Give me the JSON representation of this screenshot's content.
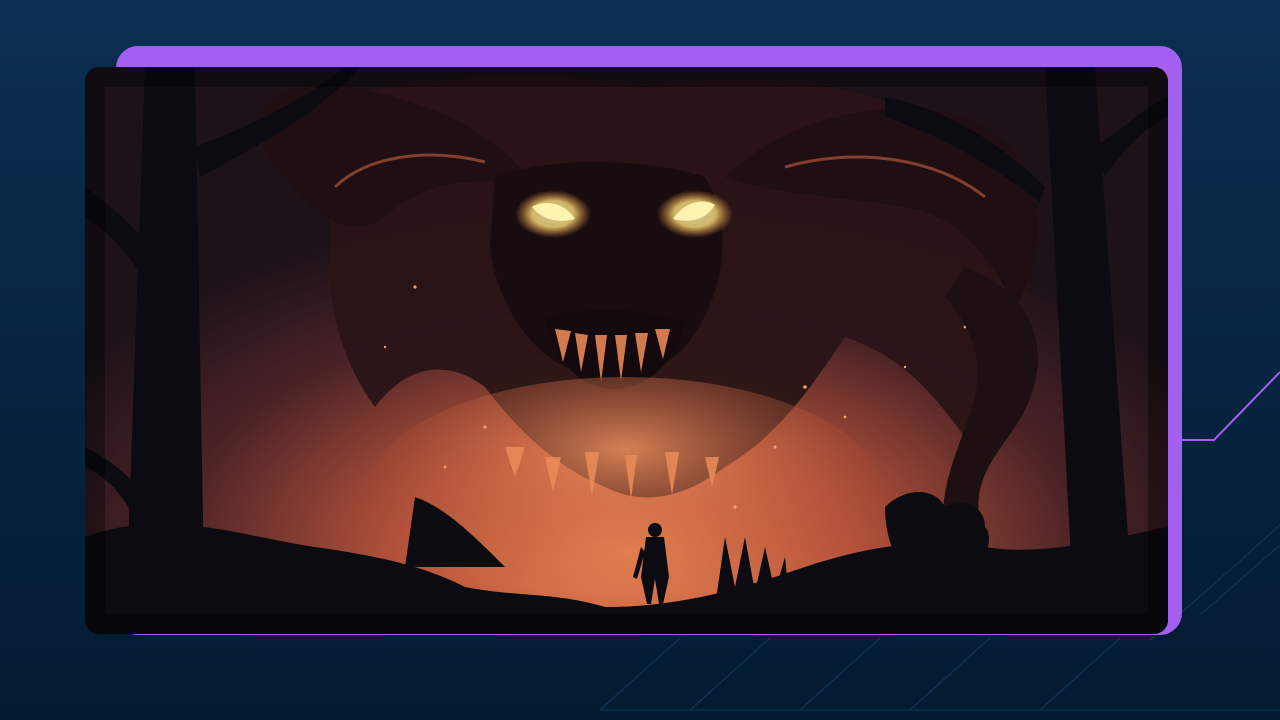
{
  "colors": {
    "background_top": "#0a2f52",
    "background_bottom": "#041a30",
    "accent_purple": "#a35ff0",
    "glow_orange": "#e07a4c",
    "eye_yellow": "#ffe98a",
    "silhouette": "#0c0b12"
  },
  "scene": {
    "subject": "demon-face-over-lone-warrior",
    "elements": [
      "horned-shadow-demon",
      "glowing-eyes",
      "fanged-maw",
      "lone-warrior-silhouette",
      "forest-trees",
      "ember-particles"
    ]
  },
  "decor": {
    "lines": [
      "diagonal-line-right",
      "diagonal-lines-bottom"
    ]
  }
}
